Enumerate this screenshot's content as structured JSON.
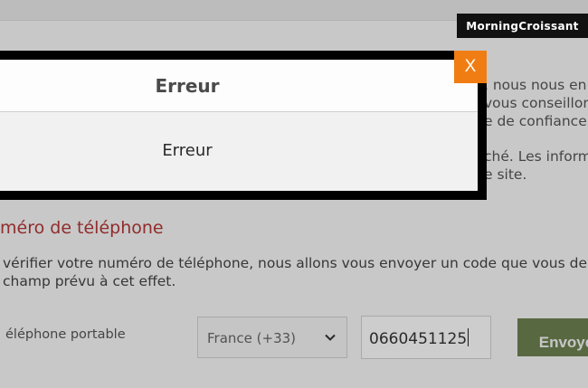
{
  "brand": {
    "logo_text": "MorningCroissant"
  },
  "background": {
    "paragraph1": [
      ", nous nous en",
      "vous conseillon",
      "e de confiance a"
    ],
    "paragraph2": [
      "ché. Les inform",
      "e site."
    ],
    "section_title": "méro de téléphone",
    "description": [
      "vérifier votre numéro de téléphone, nous allons vous envoyer un code que vous de",
      "champ prévu à cet effet."
    ],
    "phone_label": "éléphone portable",
    "country_select": {
      "value": "France (+33)",
      "icon": "chevron-down-icon"
    },
    "phone_input": {
      "value": "0660451125"
    },
    "send_button": "Envoye"
  },
  "modal": {
    "title": "Erreur",
    "message": "Erreur",
    "close_label": "X",
    "accent_color": "#f07d13"
  }
}
